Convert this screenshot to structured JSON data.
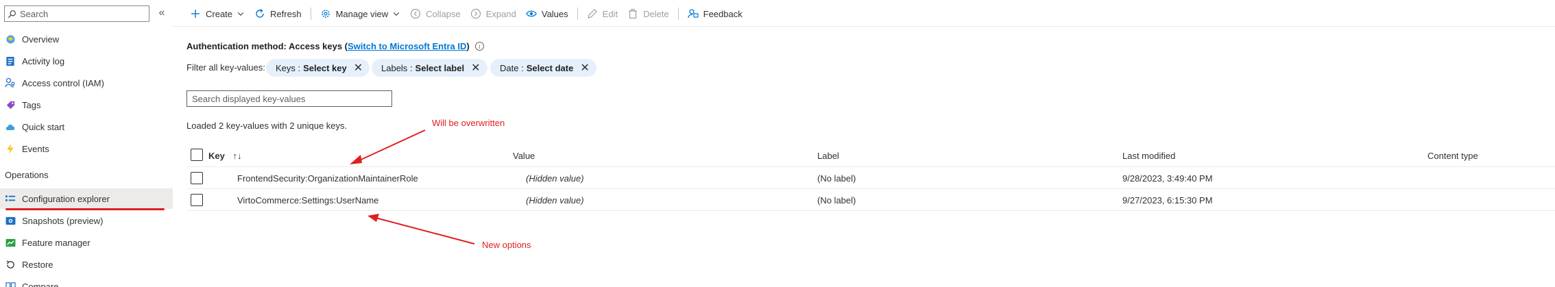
{
  "sidebar": {
    "search_placeholder": "Search",
    "collapse_glyph": "«",
    "items": [
      {
        "label": "Overview",
        "icon": "overview-icon"
      },
      {
        "label": "Activity log",
        "icon": "activity-log-icon"
      },
      {
        "label": "Access control (IAM)",
        "icon": "access-control-icon"
      },
      {
        "label": "Tags",
        "icon": "tag-icon"
      },
      {
        "label": "Quick start",
        "icon": "cloud-icon"
      },
      {
        "label": "Events",
        "icon": "lightning-icon"
      }
    ],
    "section_operations": "Operations",
    "operations_items": [
      {
        "label": "Configuration explorer",
        "icon": "config-explorer-icon",
        "selected": true
      },
      {
        "label": "Snapshots (preview)",
        "icon": "snapshot-icon"
      },
      {
        "label": "Feature manager",
        "icon": "feature-manager-icon"
      },
      {
        "label": "Restore",
        "icon": "restore-icon"
      },
      {
        "label": "Compare",
        "icon": "compare-icon"
      }
    ]
  },
  "toolbar": {
    "create": "Create",
    "refresh": "Refresh",
    "manage_view": "Manage view",
    "collapse": "Collapse",
    "expand": "Expand",
    "values": "Values",
    "edit": "Edit",
    "delete": "Delete",
    "feedback": "Feedback"
  },
  "auth": {
    "prefix": "Authentication method: Access keys (",
    "link": "Switch to Microsoft Entra ID",
    "suffix": ")",
    "info_glyph": "i"
  },
  "filters": {
    "label": "Filter all key-values:",
    "pills": [
      {
        "name": "Keys :",
        "value": "Select key"
      },
      {
        "name": "Labels :",
        "value": "Select label"
      },
      {
        "name": "Date :",
        "value": "Select date"
      }
    ]
  },
  "kv_search_placeholder": "Search displayed key-values",
  "loaded_text": "Loaded 2 key-values with 2 unique keys.",
  "table": {
    "headers": {
      "key": "Key",
      "sort": "↑↓",
      "value": "Value",
      "label": "Label",
      "last_modified": "Last modified",
      "content_type": "Content type"
    },
    "rows": [
      {
        "key": "FrontendSecurity:OrganizationMaintainerRole",
        "value": "(Hidden value)",
        "label": "(No label)",
        "last_modified": "9/28/2023, 3:49:40 PM"
      },
      {
        "key": "VirtoCommerce:Settings:UserName",
        "value": "(Hidden value)",
        "label": "(No label)",
        "last_modified": "9/27/2023, 6:15:30 PM"
      }
    ]
  },
  "annotations": {
    "overwritten": "Will be overwritten",
    "new_options": "New options"
  },
  "colors": {
    "accent": "#0078d4",
    "annotation_red": "#e01e1e",
    "pill_bg": "#e6f0fb"
  }
}
